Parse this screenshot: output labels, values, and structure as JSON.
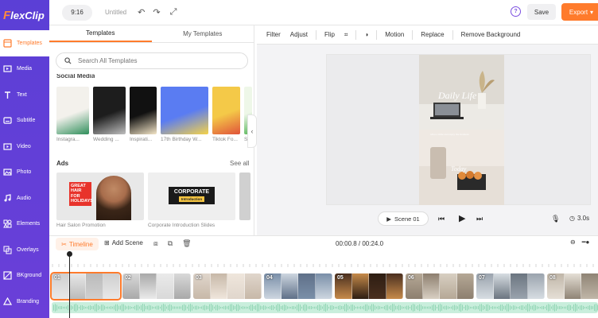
{
  "app": {
    "logo_initial": "F",
    "logo_rest": "lexClip"
  },
  "sidebar": {
    "items": [
      {
        "label": "Templates",
        "icon": "templates-icon",
        "active": true
      },
      {
        "label": "Media",
        "icon": "media-icon"
      },
      {
        "label": "Text",
        "icon": "text-icon"
      },
      {
        "label": "Subtitle",
        "icon": "subtitle-icon"
      },
      {
        "label": "Video",
        "icon": "video-icon"
      },
      {
        "label": "Photo",
        "icon": "photo-icon"
      },
      {
        "label": "Audio",
        "icon": "audio-icon"
      },
      {
        "label": "Elements",
        "icon": "elements-icon"
      },
      {
        "label": "Overlays",
        "icon": "overlays-icon"
      },
      {
        "label": "BKground",
        "icon": "background-icon"
      },
      {
        "label": "Branding",
        "icon": "branding-icon"
      }
    ]
  },
  "topbar": {
    "ratio": "9:16",
    "title": "Untitled",
    "save": "Save",
    "export": "Export",
    "help": "?"
  },
  "panel": {
    "tabs": [
      "Templates",
      "My Templates"
    ],
    "search_placeholder": "Search All Templates",
    "section_cut": "Social Media",
    "social": [
      {
        "label": "Instagra...",
        "colors": [
          "#f3f1ec",
          "#2f8f5b"
        ]
      },
      {
        "label": "Wedding ...",
        "colors": [
          "#1d1d1d",
          "#bfbfbf"
        ]
      },
      {
        "label": "Inspirati...",
        "colors": [
          "#111111",
          "#f4e6c8"
        ]
      },
      {
        "label": "17th Birthday W...",
        "colors": [
          "#5a7cf2",
          "#f5d348"
        ]
      },
      {
        "label": "Tiktok Fo...",
        "colors": [
          "#f4c948",
          "#e0533a"
        ]
      },
      {
        "label": "Sp...",
        "colors": [
          "#eef7e8",
          "#5cb85c"
        ]
      }
    ],
    "ads_title": "Ads",
    "see_all": "See all",
    "ads": [
      {
        "label": "Hair Salon Promotion",
        "headline": "GREAT HAIR FOR HOLIDAYS",
        "colors": [
          "#e8e8e8",
          "#e8332b"
        ]
      },
      {
        "label": "Corporate Introduction Slides",
        "headline": "CORPORATE",
        "sub": "Introduction",
        "colors": [
          "#efefef",
          "#1a1a1a",
          "#f5c542"
        ]
      },
      {
        "label": "",
        "colors": [
          "#d0d0d0"
        ]
      }
    ]
  },
  "toolbar": {
    "items": [
      "Filter",
      "Adjust",
      "Flip",
      "Motion",
      "Replace",
      "Remove Background"
    ]
  },
  "canvas": {
    "headline": "Daily Life",
    "subline": "what a little and enjoy the moment",
    "caption": "Today",
    "scene_label": "Scene  01",
    "duration": "3.0s"
  },
  "timeline": {
    "label": "Timeline",
    "add_scene": "Add Scene",
    "time_readout": "00:00.8 / 00:24.0",
    "clips": [
      {
        "num": "01",
        "colors": [
          "#cfcfcf",
          "#e8e8e8",
          "#bbbbbb"
        ]
      },
      {
        "num": "02",
        "colors": [
          "#d9d9d9",
          "#a9a9a9",
          "#eaeaea"
        ]
      },
      {
        "num": "03",
        "colors": [
          "#e0d6cc",
          "#c7b8a8",
          "#efe6dc"
        ]
      },
      {
        "num": "04",
        "colors": [
          "#7a8fa8",
          "#cdd6e0",
          "#5f7088"
        ]
      },
      {
        "num": "05",
        "colors": [
          "#4a2f1f",
          "#c68a4a",
          "#2d1d12"
        ]
      },
      {
        "num": "06",
        "colors": [
          "#b5a896",
          "#8d7f6f",
          "#d8cfc2"
        ]
      },
      {
        "num": "07",
        "colors": [
          "#9aa3ad",
          "#d7dde2",
          "#6b7580"
        ]
      },
      {
        "num": "08",
        "colors": [
          "#c0b6a8",
          "#e5dfd6",
          "#8f8475"
        ]
      }
    ]
  },
  "colors": {
    "brand": "#6a3fd8",
    "accent": "#ff7b2c",
    "audio": "#c9eedc"
  }
}
